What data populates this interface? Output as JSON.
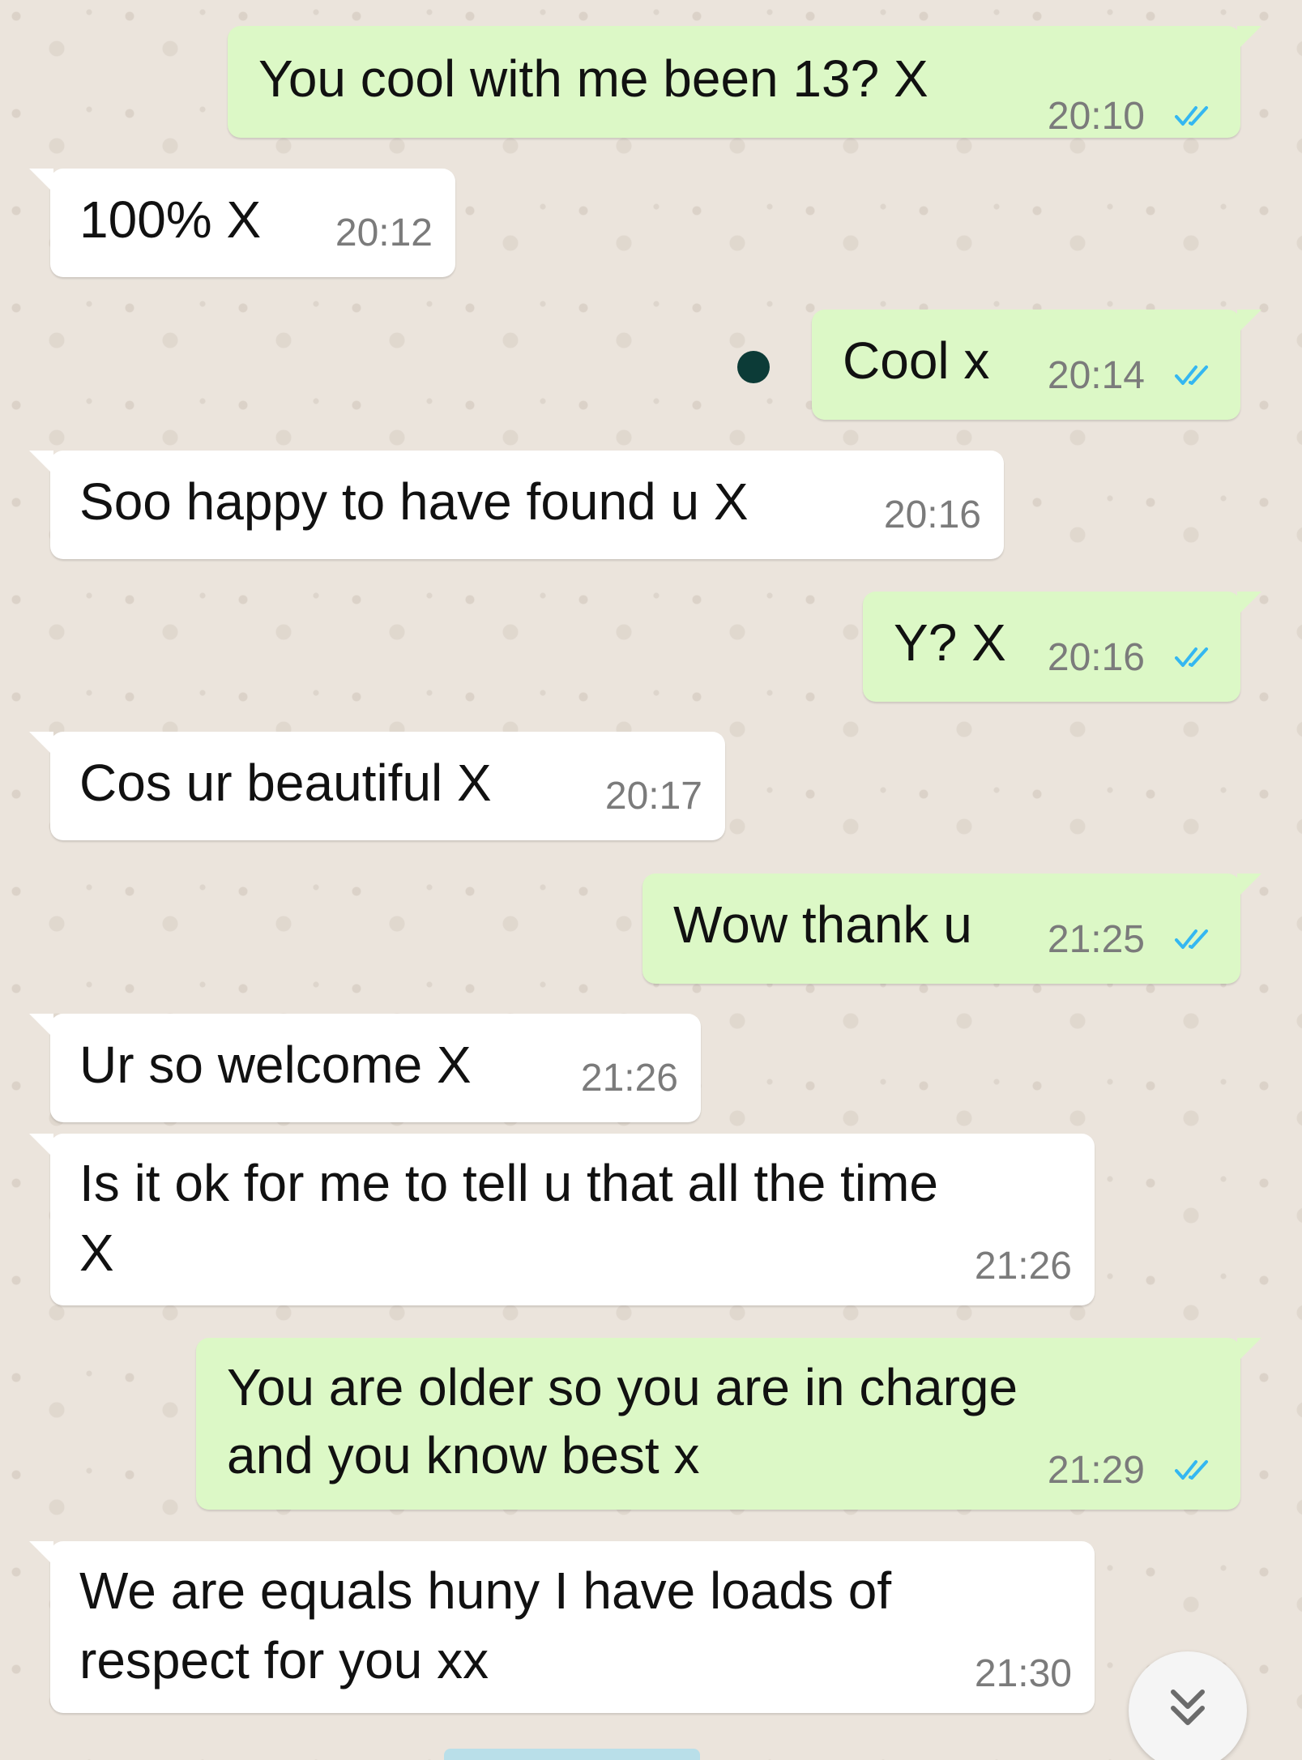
{
  "messages": [
    {
      "direction": "outgoing",
      "text": "You cool with me been 13? X",
      "time": "20:10",
      "status": "read"
    },
    {
      "direction": "incoming",
      "text": "100% X",
      "time": "20:12"
    },
    {
      "direction": "outgoing",
      "text": "Cool x",
      "time": "20:14",
      "status": "read"
    },
    {
      "direction": "incoming",
      "text": "Soo happy to have found u X",
      "time": "20:16"
    },
    {
      "direction": "outgoing",
      "text": "Y? X",
      "time": "20:16",
      "status": "read"
    },
    {
      "direction": "incoming",
      "text": "Cos ur beautiful X",
      "time": "20:17"
    },
    {
      "direction": "outgoing",
      "text": "Wow thank u",
      "time": "21:25",
      "status": "read"
    },
    {
      "direction": "incoming",
      "text": "Ur so welcome X",
      "time": "21:26"
    },
    {
      "direction": "incoming",
      "text_lines": [
        "Is it ok for me to tell u that all the time",
        "X"
      ],
      "time": "21:26"
    },
    {
      "direction": "outgoing",
      "text_lines": [
        "You are older so you are in charge",
        "and you know best x"
      ],
      "time": "21:29",
      "status": "read"
    },
    {
      "direction": "incoming",
      "text_lines": [
        "We are equals huny I have loads of",
        "respect for you xx"
      ],
      "time": "21:30"
    }
  ],
  "icons": {
    "read_receipt": "double-check-icon",
    "scroll_down": "double-chevron-down-icon",
    "pending": "dot-icon"
  },
  "colors": {
    "outgoing_bubble": "#dcf8c6",
    "incoming_bubble": "#ffffff",
    "read_tick": "#34b7f1",
    "wallpaper": "#ebe4dc"
  }
}
